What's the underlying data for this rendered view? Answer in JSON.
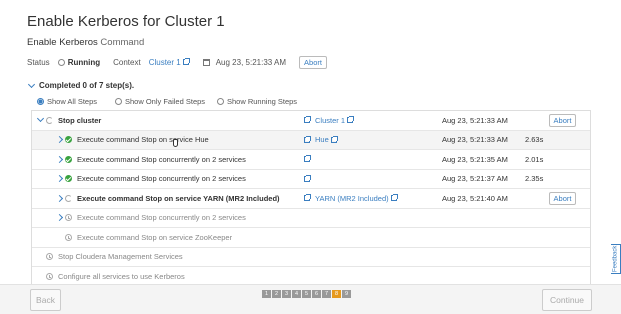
{
  "page": {
    "title": "Enable Kerberos for Cluster 1",
    "subtitle_cmd": "Enable Kerberos",
    "subtitle_word": "Command"
  },
  "status": {
    "status_label": "Status",
    "status_value": "Running",
    "context_label": "Context",
    "context_value": "Cluster 1",
    "date": "Aug 23, 5:21:33 AM",
    "abort": "Abort"
  },
  "completed": "Completed 0 of 7 step(s).",
  "filters": [
    "Show All Steps",
    "Show Only Failed Steps",
    "Show Running Steps"
  ],
  "steps": [
    {
      "label": "Stop cluster",
      "state": "running",
      "expand": "down",
      "target": "Cluster 1",
      "time": "Aug 23, 5:21:33 AM",
      "duration": "",
      "abort": "Abort",
      "indent": 0,
      "bold": true
    },
    {
      "label": "Execute command Stop on service Hue",
      "state": "ok",
      "expand": "right",
      "target": "Hue",
      "time": "Aug 23, 5:21:33 AM",
      "duration": "2.63s",
      "abort": "",
      "indent": 1,
      "bold": false
    },
    {
      "label": "Execute command Stop concurrently on 2 services",
      "state": "ok",
      "expand": "right",
      "target": "",
      "time": "Aug 23, 5:21:35 AM",
      "duration": "2.01s",
      "abort": "",
      "indent": 1,
      "bold": false
    },
    {
      "label": "Execute command Stop concurrently on 2 services",
      "state": "ok",
      "expand": "right",
      "target": "",
      "time": "Aug 23, 5:21:37 AM",
      "duration": "2.35s",
      "abort": "",
      "indent": 1,
      "bold": false
    },
    {
      "label": "Execute command Stop on service YARN (MR2 Included)",
      "state": "running",
      "expand": "right",
      "target": "YARN (MR2 Included)",
      "time": "Aug 23, 5:21:40 AM",
      "duration": "",
      "abort": "Abort",
      "indent": 1,
      "bold": true
    },
    {
      "label": "Execute command Stop concurrently on 2 services",
      "state": "pending",
      "expand": "right",
      "target": "",
      "time": "",
      "duration": "",
      "abort": "",
      "indent": 1,
      "bold": false
    },
    {
      "label": "Execute command Stop on service ZooKeeper",
      "state": "pending",
      "expand": "",
      "target": "",
      "time": "",
      "duration": "",
      "abort": "",
      "indent": 1,
      "bold": false
    },
    {
      "label": "Stop Cloudera Management Services",
      "state": "pending",
      "expand": "",
      "target": "",
      "time": "",
      "duration": "",
      "abort": "",
      "indent": 0,
      "bold": false
    },
    {
      "label": "Configure all services to use Kerberos",
      "state": "pending",
      "expand": "",
      "target": "",
      "time": "",
      "duration": "",
      "abort": "",
      "indent": 0,
      "bold": false
    }
  ],
  "footer": {
    "back": "Back",
    "continue": "Continue",
    "pages": [
      "1",
      "2",
      "3",
      "4",
      "5",
      "6",
      "7",
      "8",
      "9"
    ],
    "current_page": "8"
  },
  "feedback": "Feedback",
  "colors": {
    "accent": "#3a7ec0",
    "success": "#3aa340",
    "current_page": "#e69a1f"
  }
}
